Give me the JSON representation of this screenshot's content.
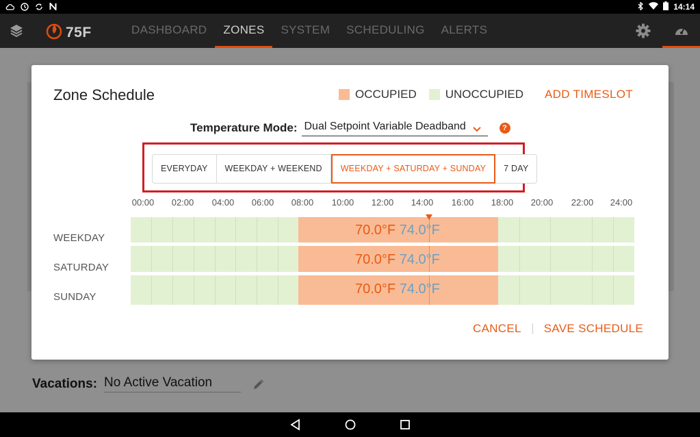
{
  "statusbar": {
    "time": "14:14",
    "left_icons": [
      "cloud-icon",
      "clock-icon",
      "sync-icon",
      "n-icon"
    ],
    "right_icons": [
      "bluetooth-icon",
      "wifi-icon",
      "battery-icon"
    ]
  },
  "navbar": {
    "logo_text": "75F",
    "items": [
      {
        "label": "DASHBOARD",
        "active": false
      },
      {
        "label": "ZONES",
        "active": true
      },
      {
        "label": "SYSTEM",
        "active": false
      },
      {
        "label": "SCHEDULING",
        "active": false
      },
      {
        "label": "ALERTS",
        "active": false
      }
    ],
    "accent_color": "#e24c0c"
  },
  "modal": {
    "title": "Zone Schedule",
    "legend": {
      "occupied": "OCCUPIED",
      "unoccupied": "UNOCCUPIED"
    },
    "add_timeslot": "ADD TIMESLOT",
    "temperature_mode": {
      "label": "Temperature Mode:",
      "value": "Dual Setpoint Variable Deadband"
    },
    "schedule_types": [
      {
        "label": "EVERYDAY",
        "selected": false
      },
      {
        "label": "WEEKDAY + WEEKEND",
        "selected": false
      },
      {
        "label": "WEEKDAY + SATURDAY + SUNDAY",
        "selected": true
      },
      {
        "label": "7 DAY",
        "selected": false
      }
    ],
    "hours": [
      "00:00",
      "02:00",
      "04:00",
      "06:00",
      "08:00",
      "10:00",
      "12:00",
      "14:00",
      "16:00",
      "18:00",
      "20:00",
      "22:00",
      "24:00"
    ],
    "rows": [
      {
        "label": "WEEKDAY",
        "heat": "70.0°F",
        "cool": "74.0°F"
      },
      {
        "label": "SATURDAY",
        "heat": "70.0°F",
        "cool": "74.0°F"
      },
      {
        "label": "SUNDAY",
        "heat": "70.0°F",
        "cool": "74.0°F"
      }
    ],
    "cancel": "CANCEL",
    "save": "SAVE SCHEDULE",
    "colors": {
      "occupied": "#f9bb95",
      "unoccupied": "#e2f1d2",
      "accent": "#e85b16",
      "cool_text": "#6aa0c8"
    }
  },
  "vacations": {
    "label": "Vacations:",
    "value": "No Active Vacation"
  }
}
